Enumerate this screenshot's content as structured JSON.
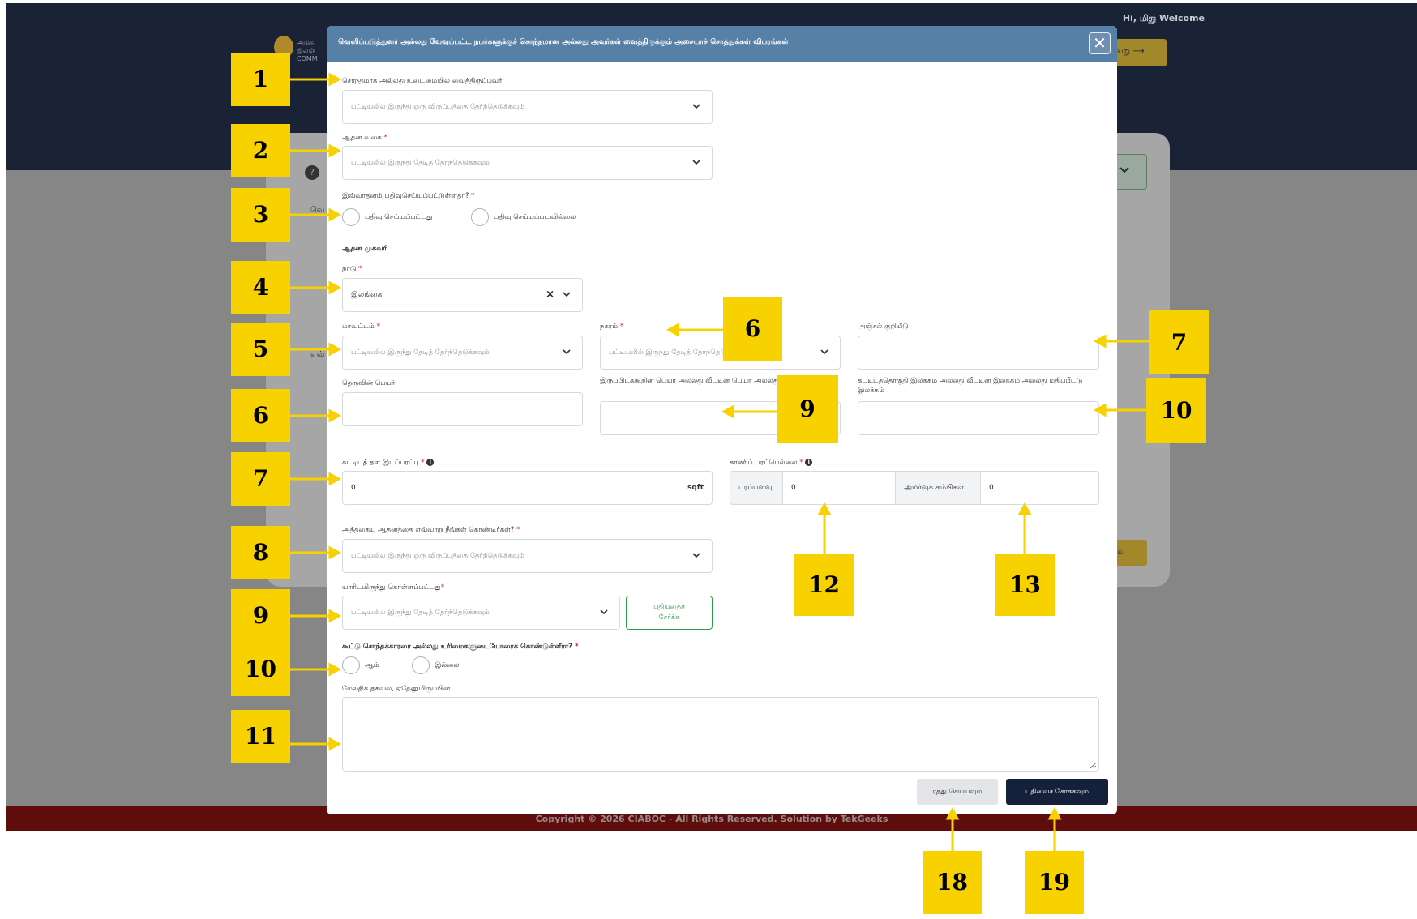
{
  "header": {
    "greeting": "Hi, மிது Welcome",
    "next_label": "வேறு ⟶"
  },
  "background": {
    "logo_line1": "அடுத",
    "logo_line2": "இலஞ்",
    "logo_line3": "COMM",
    "help_glyph": "?",
    "side_btn_label": "வம்",
    "side_letter1": "வெ",
    "side_letter2": "எவ்"
  },
  "modal": {
    "title": "வெளிப்படுத்துனர் அல்லது வேவுப்பட்ட நபர்களுக்குச் சொந்தமான அல்லது அவர்கள் வைத்திருக்கும் அசையாச் சொத்துக்கள் விபரங்கள்",
    "close_glyph": "✕",
    "owner": {
      "label": "சொந்தமாக அல்லது உடைமையில் வைத்திருப்பவர்",
      "placeholder": "பட்டியலில் இருந்து ஒரு விருப்பத்தை தேர்ந்தெடுக்கவும்"
    },
    "property_type": {
      "label": "ஆதன வகை",
      "placeholder": "பட்டியலில் இருந்து தேடித் தேர்ந்தெடுக்கவும்"
    },
    "registered": {
      "label": "இவ்வாதனம் பதிவுசெய்யப்பட்டுள்ளதா?",
      "option_yes": "பதிவு செய்யப்பட்டது",
      "option_no": "பதிவு செய்யப்படவில்லை"
    },
    "address_heading": "ஆதன முகவரி",
    "country": {
      "label": "நாடு",
      "value": "இலங்கை",
      "clear_glyph": "×"
    },
    "district": {
      "label": "மாவட்டம்",
      "placeholder": "பட்டியலில் இருந்து தேடித் தேர்ந்தெடுக்கவும்"
    },
    "city": {
      "label": "நகரம்",
      "placeholder": "பட்டியலில் இருந்து தேடித் தேர்ந்தெடுக்கவும்"
    },
    "postal_code": {
      "label": "அஞ்சல் குறியீடு",
      "value": ""
    },
    "street": {
      "label": "தெருவின் பெயர்",
      "value": ""
    },
    "residence_name": {
      "label": "இருப்பிடக்கூறின் பெயர் அல்லது வீட்டின் பெயர் அல்லது காணியின் பெயர்",
      "value": ""
    },
    "building_number": {
      "label": "கட்டிடத்தொகுதி இலக்கம் அல்லது வீட்டின் இலக்கம் அல்லது மதிப்பீட்டு இலக்கம்",
      "value": ""
    },
    "floor_area": {
      "label": "கட்டிடத் தள இடப்பரப்பு",
      "value": "0",
      "unit": "sqft"
    },
    "land_area": {
      "label": "காணிப் பரப்பெல்லை",
      "unit_a": "பரப்பளவு",
      "value_a": "0",
      "unit_b": "அமர்வுக் கம்பிகள்",
      "value_b": "0"
    },
    "acquisition": {
      "label": "அத்தகைய ஆதனத்தை எவ்வாறு நீங்கள் கொண்டீர்கள்?",
      "placeholder": "பட்டியலில் இருந்து ஒரு விருப்பத்தை தேர்ந்தெடுக்கவும்"
    },
    "acquired_from": {
      "label": "யாரிடமிருந்து கொள்ளப்பட்டது",
      "placeholder": "பட்டியலில் இருந்து தேடித் தேர்ந்தெடுக்கவும்",
      "add_line1": "புதியதைச்",
      "add_line2": "சேர்க்க"
    },
    "co_owners": {
      "label": "கூட்டு சொந்தக்காரரை அல்லது உரிமைகளுடையோரைக் கொண்டுள்ளீரா?",
      "option_yes": "ஆம்",
      "option_no": "இல்லை"
    },
    "additional_info": {
      "label": "மேலதிக தகவல், ஏதேனுமிருப்பின்"
    },
    "cancel_label": "ரத்து செய்யவும்",
    "submit_label": "பதிவைச் சேர்க்கவும்"
  },
  "footer": {
    "text": "Copyright © 2026 CIABOC - All Rights Reserved. Solution by TekGeeks"
  },
  "annotations": {
    "c1": "1",
    "c2": "2",
    "c3": "3",
    "c4": "4",
    "c5": "5",
    "c6a": "6",
    "c6b": "6",
    "c7a": "7",
    "c7b": "7",
    "c8": "8",
    "c9a": "9",
    "c9b": "9",
    "c10a": "10",
    "c10b": "10",
    "c11": "11",
    "c12": "12",
    "c13": "13",
    "c18": "18",
    "c19": "19"
  }
}
